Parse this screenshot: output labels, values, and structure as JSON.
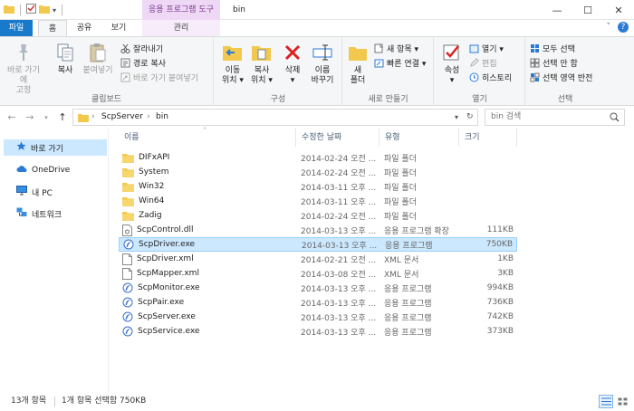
{
  "window": {
    "title": "bin",
    "context_group": "응용 프로그램 도구",
    "controls": {
      "minimize": "—",
      "maximize": "☐",
      "close": "✕"
    }
  },
  "tabs": [
    {
      "label": "파일"
    },
    {
      "label": "홈"
    },
    {
      "label": "공유"
    },
    {
      "label": "보기"
    },
    {
      "label": "관리"
    }
  ],
  "ribbon": {
    "clipboard": {
      "label": "클립보드",
      "pin": "바로 가기에\n고정",
      "copy": "복사",
      "paste": "붙여넣기",
      "cut": "잘라내기",
      "copy_path": "경로 복사",
      "paste_shortcut": "바로 가기 붙여넣기"
    },
    "organize": {
      "label": "구성",
      "move_to": "이동\n위치 ▾",
      "copy_to": "복사\n위치 ▾",
      "delete": "삭제\n▾",
      "rename": "이름\n바꾸기"
    },
    "new": {
      "label": "새로 만들기",
      "new_folder": "새\n폴더",
      "new_item": "새 항목 ▾",
      "easy_access": "빠른 연결 ▾"
    },
    "open": {
      "label": "열기",
      "properties": "속성\n▾",
      "open": "열기 ▾",
      "edit": "편집",
      "history": "히스토리"
    },
    "select": {
      "label": "선택",
      "select_all": "모두 선택",
      "select_none": "선택 안 함",
      "invert": "선택 영역 반전"
    }
  },
  "address": {
    "crumbs": [
      "ScpServer",
      "bin"
    ],
    "search_placeholder": "bin 검색"
  },
  "nav_pane": {
    "items": [
      {
        "label": "바로 가기"
      },
      {
        "label": "OneDrive"
      },
      {
        "label": "내 PC"
      },
      {
        "label": "네트워크"
      }
    ]
  },
  "columns": {
    "name": "이름",
    "date": "수정한 날짜",
    "type": "유형",
    "size": "크기"
  },
  "files": [
    {
      "name": "DIFxAPI",
      "date": "2014-02-24 오전 ...",
      "type": "파일 폴더",
      "size": "",
      "icon": "folder"
    },
    {
      "name": "System",
      "date": "2014-02-24 오전 ...",
      "type": "파일 폴더",
      "size": "",
      "icon": "folder"
    },
    {
      "name": "Win32",
      "date": "2014-03-11 오후 ...",
      "type": "파일 폴더",
      "size": "",
      "icon": "folder"
    },
    {
      "name": "Win64",
      "date": "2014-03-11 오후 ...",
      "type": "파일 폴더",
      "size": "",
      "icon": "folder"
    },
    {
      "name": "Zadig",
      "date": "2014-02-24 오전 ...",
      "type": "파일 폴더",
      "size": "",
      "icon": "folder"
    },
    {
      "name": "ScpControl.dll",
      "date": "2014-03-13 오후 ...",
      "type": "응용 프로그램 확장",
      "size": "111KB",
      "icon": "dll"
    },
    {
      "name": "ScpDriver.exe",
      "date": "2014-03-13 오후 ...",
      "type": "응용 프로그램",
      "size": "750KB",
      "icon": "exe"
    },
    {
      "name": "ScpDriver.xml",
      "date": "2014-02-21 오전 ...",
      "type": "XML 문서",
      "size": "1KB",
      "icon": "doc"
    },
    {
      "name": "ScpMapper.xml",
      "date": "2014-03-08 오전 ...",
      "type": "XML 문서",
      "size": "3KB",
      "icon": "doc"
    },
    {
      "name": "ScpMonitor.exe",
      "date": "2014-03-13 오후 ...",
      "type": "응용 프로그램",
      "size": "994KB",
      "icon": "exe"
    },
    {
      "name": "ScpPair.exe",
      "date": "2014-03-13 오후 ...",
      "type": "응용 프로그램",
      "size": "736KB",
      "icon": "exe"
    },
    {
      "name": "ScpServer.exe",
      "date": "2014-03-13 오후 ...",
      "type": "응용 프로그램",
      "size": "742KB",
      "icon": "exe"
    },
    {
      "name": "ScpService.exe",
      "date": "2014-03-13 오후 ...",
      "type": "응용 프로그램",
      "size": "373KB",
      "icon": "exe"
    }
  ],
  "selected_file": "ScpDriver.exe",
  "status": {
    "count": "13개 항목",
    "selection": "1개 항목 선택함 750KB"
  },
  "colors": {
    "accent": "#1979ca",
    "selection": "#cce8ff",
    "folder": "#f2c94c",
    "context": "#efd8f5"
  }
}
